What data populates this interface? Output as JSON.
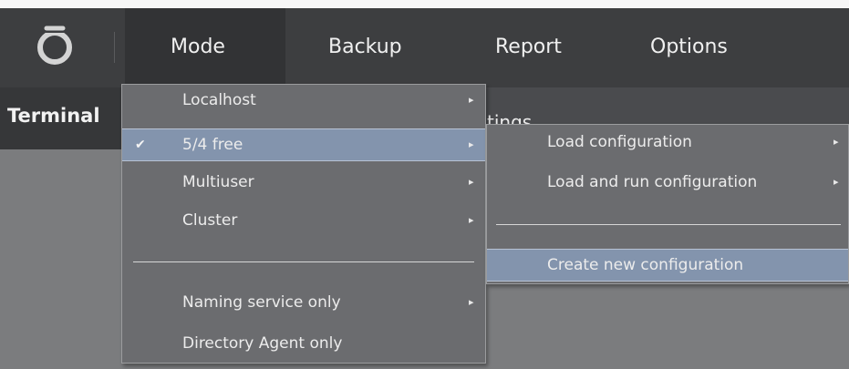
{
  "menubar": {
    "items": [
      {
        "label": "Mode"
      },
      {
        "label": "Backup"
      },
      {
        "label": "Report"
      },
      {
        "label": "Options"
      }
    ]
  },
  "tabs": {
    "terminal": "Terminal",
    "settings_partial": "tings"
  },
  "mode_menu": {
    "items": [
      {
        "label": "Localhost",
        "has_submenu": true,
        "checked": false
      },
      {
        "label": "5/4 free",
        "has_submenu": true,
        "checked": true,
        "check_mark": "✔"
      },
      {
        "label": "Multiuser",
        "has_submenu": true,
        "checked": false
      },
      {
        "label": "Cluster",
        "has_submenu": true,
        "checked": false
      },
      {
        "label": "Naming service only",
        "has_submenu": true,
        "checked": false
      },
      {
        "label": "Directory Agent only",
        "has_submenu": false,
        "checked": false
      }
    ]
  },
  "submenu": {
    "items": [
      {
        "label": "Load configuration",
        "has_submenu": true
      },
      {
        "label": "Load and run configuration",
        "has_submenu": true
      },
      {
        "label": "Create new configuration",
        "has_submenu": false
      }
    ]
  },
  "icons": {
    "submenu_arrow": "▸",
    "logo": "app-logo-icon"
  },
  "colors": {
    "menubar_bg": "#3d3e40",
    "menu_bg": "#6b6c6f",
    "highlight": "#8394ad",
    "page_bg": "#7b7c7e"
  }
}
